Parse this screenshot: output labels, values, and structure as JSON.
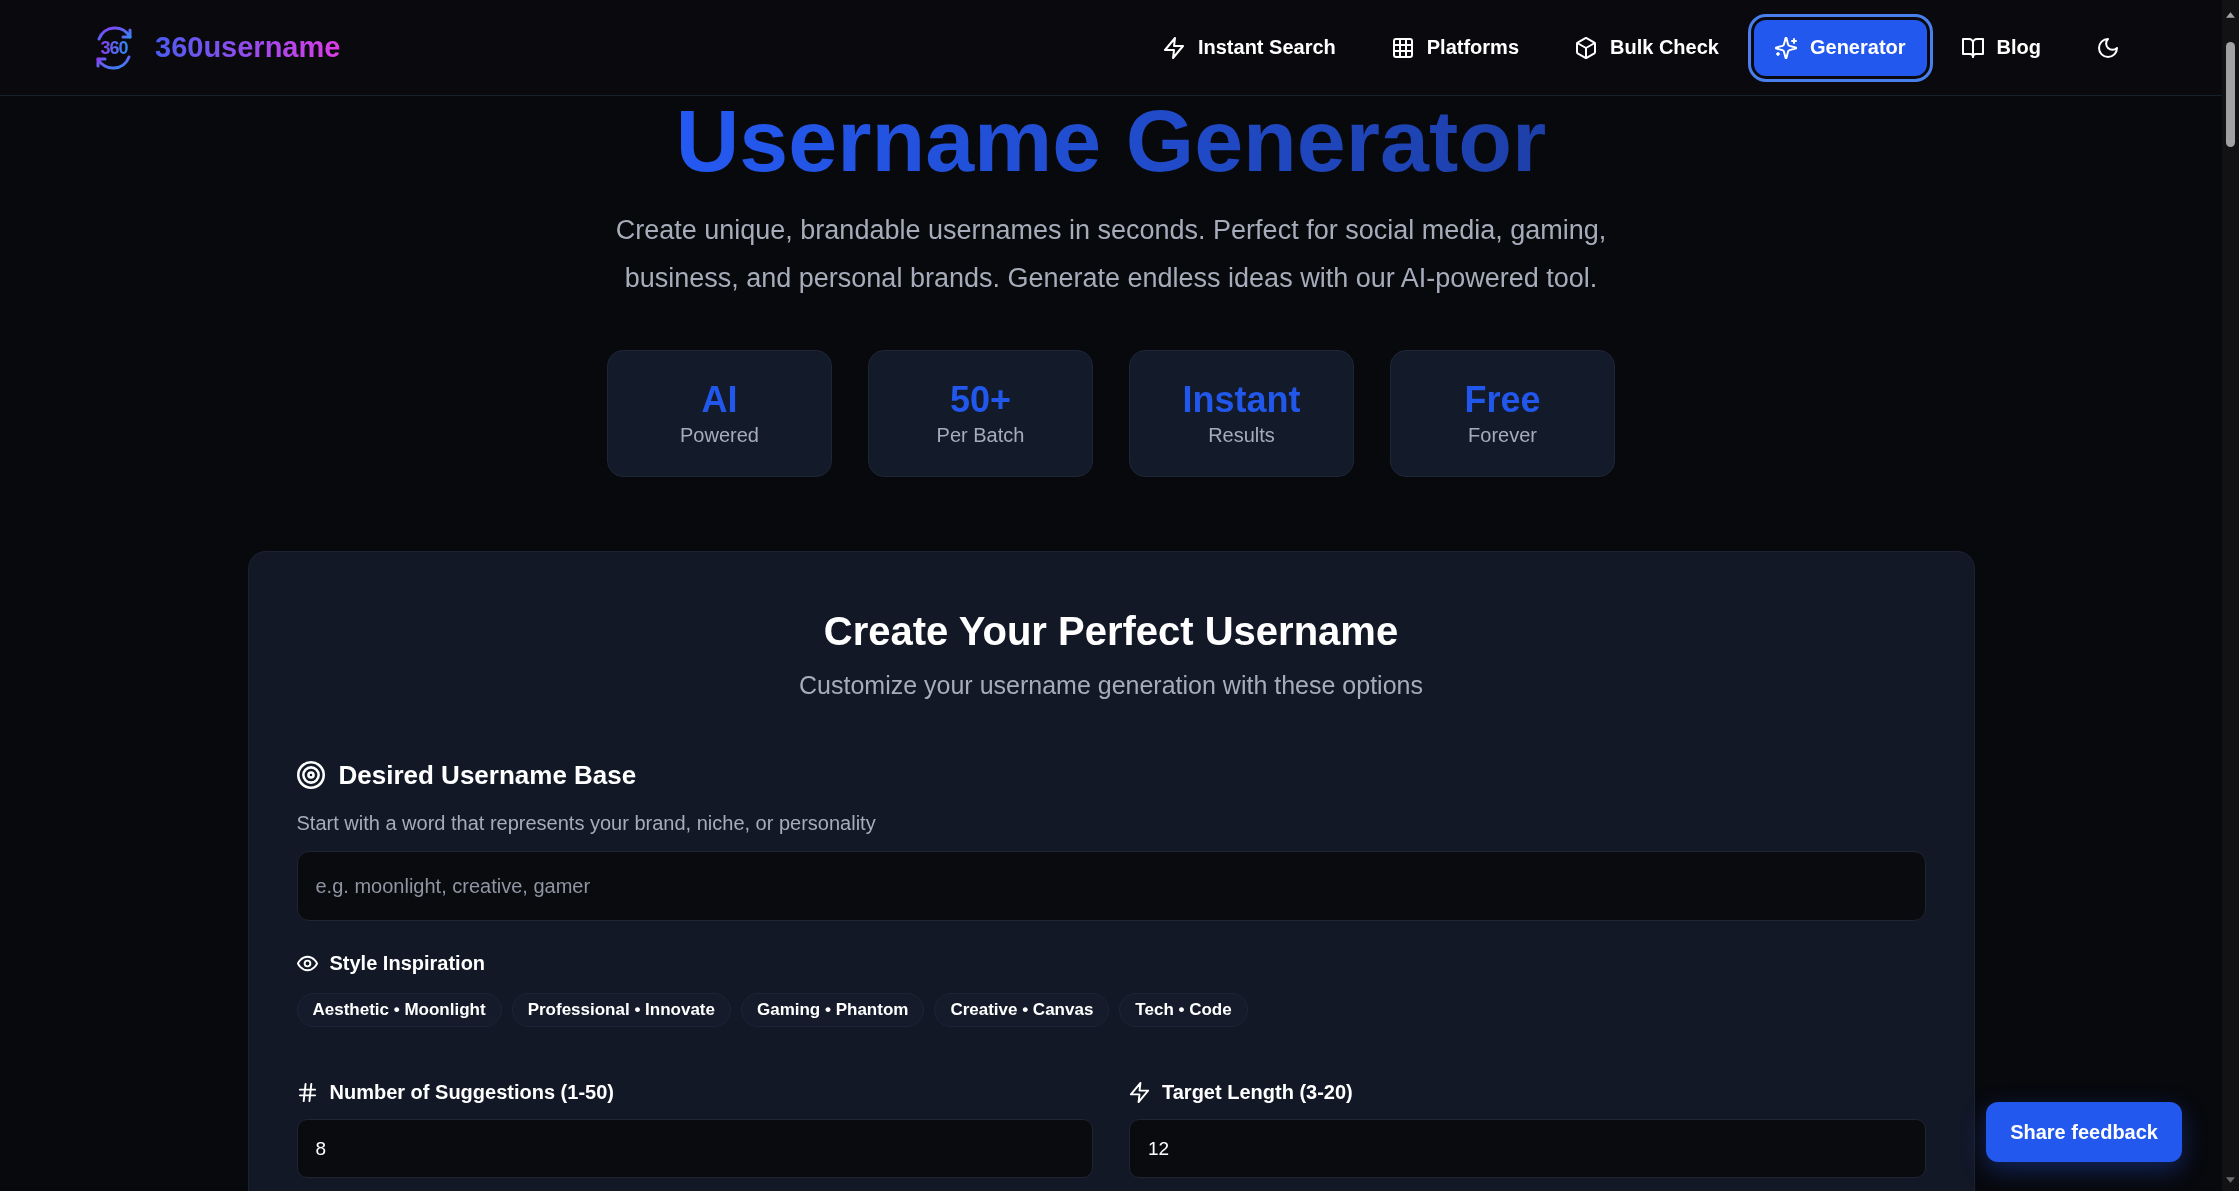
{
  "header": {
    "logo_mark": "360",
    "brand": "360username",
    "nav": [
      {
        "label": "Instant Search",
        "selected": false
      },
      {
        "label": "Platforms",
        "selected": false
      },
      {
        "label": "Bulk Check",
        "selected": false
      },
      {
        "label": "Generator",
        "selected": true
      },
      {
        "label": "Blog",
        "selected": false
      }
    ]
  },
  "hero": {
    "title": "Username Generator",
    "subtitle": "Create unique, brandable usernames in seconds. Perfect for social media, gaming, business, and personal brands. Generate endless ideas with our AI-powered tool.",
    "stats": [
      {
        "value": "AI",
        "label": "Powered"
      },
      {
        "value": "50+",
        "label": "Per Batch"
      },
      {
        "value": "Instant",
        "label": "Results"
      },
      {
        "value": "Free",
        "label": "Forever"
      }
    ]
  },
  "form": {
    "title": "Create Your Perfect Username",
    "subtitle": "Customize your username generation with these options",
    "base": {
      "label": "Desired Username Base",
      "hint": "Start with a word that represents your brand, niche, or personality",
      "placeholder": "e.g. moonlight, creative, gamer"
    },
    "style": {
      "label": "Style Inspiration",
      "chips": [
        "Aesthetic • Moonlight",
        "Professional • Innovate",
        "Gaming • Phantom",
        "Creative • Canvas",
        "Tech • Code"
      ]
    },
    "fields": [
      {
        "label": "Number of Suggestions (1-50)",
        "value": "8"
      },
      {
        "label": "Target Length (3-20)",
        "value": "12"
      }
    ]
  },
  "feedback_button": "Share feedback"
}
